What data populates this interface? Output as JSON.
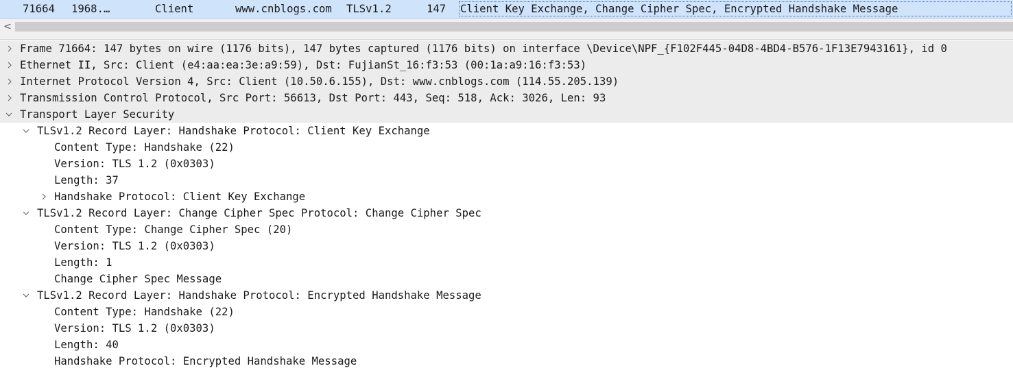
{
  "packet": {
    "no": "71664",
    "time": "1968.…",
    "source": "Client",
    "destination": "www.cnblogs.com",
    "protocol": "TLSv1.2",
    "length": "147",
    "info": "Client Key Exchange, Change Cipher Spec, Encrypted Handshake Message"
  },
  "scrollbar": {
    "left_arrow": "<"
  },
  "tree": {
    "frame": "Frame 71664: 147 bytes on wire (1176 bits), 147 bytes captured (1176 bits) on interface \\Device\\NPF_{F102F445-04D8-4BD4-B576-1F13E7943161}, id 0",
    "ethernet": "Ethernet II, Src: Client (e4:aa:ea:3e:a9:59), Dst: FujianSt_16:f3:53 (00:1a:a9:16:f3:53)",
    "ip": "Internet Protocol Version 4, Src: Client (10.50.6.155), Dst: www.cnblogs.com (114.55.205.139)",
    "tcp": "Transmission Control Protocol, Src Port: 56613, Dst Port: 443, Seq: 518, Ack: 3026, Len: 93",
    "tls": "Transport Layer Security",
    "records": [
      {
        "title": "TLSv1.2 Record Layer: Handshake Protocol: Client Key Exchange",
        "content_type": "Content Type: Handshake (22)",
        "version": "Version: TLS 1.2 (0x0303)",
        "length": "Length: 37",
        "extra": "Handshake Protocol: Client Key Exchange"
      },
      {
        "title": "TLSv1.2 Record Layer: Change Cipher Spec Protocol: Change Cipher Spec",
        "content_type": "Content Type: Change Cipher Spec (20)",
        "version": "Version: TLS 1.2 (0x0303)",
        "length": "Length: 1",
        "extra": "Change Cipher Spec Message"
      },
      {
        "title": "TLSv1.2 Record Layer: Handshake Protocol: Encrypted Handshake Message",
        "content_type": "Content Type: Handshake (22)",
        "version": "Version: TLS 1.2 (0x0303)",
        "length": "Length: 40",
        "extra": "Handshake Protocol: Encrypted Handshake Message"
      }
    ]
  },
  "colors": {
    "selected_row": "#cfe3fb",
    "shaded_row": "#ececec",
    "text": "#1a1a1a"
  }
}
